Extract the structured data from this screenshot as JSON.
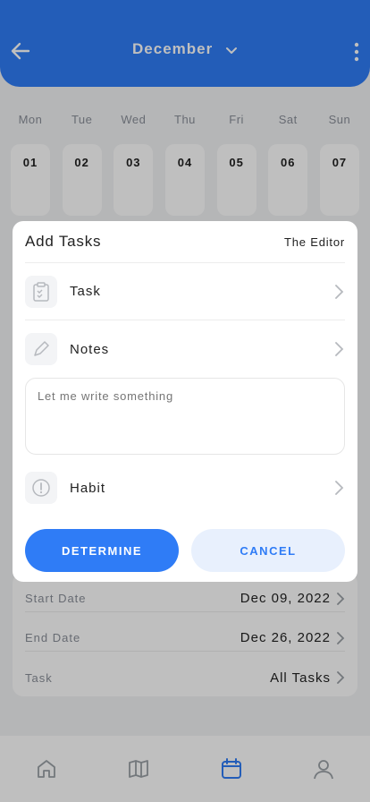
{
  "header": {
    "month": "December",
    "back_icon": "arrow-left-icon",
    "more_icon": "more-vertical-icon",
    "color": "#2f7cf6"
  },
  "week": [
    {
      "name": "Mon",
      "num": "01"
    },
    {
      "name": "Tue",
      "num": "02"
    },
    {
      "name": "Wed",
      "num": "03"
    },
    {
      "name": "Thu",
      "num": "04"
    },
    {
      "name": "Fri",
      "num": "05"
    },
    {
      "name": "Sat",
      "num": "06"
    },
    {
      "name": "Sun",
      "num": "07"
    }
  ],
  "dates": {
    "start_label": "Start Date",
    "start_value": "Dec 09, 2022",
    "end_label": "End Date",
    "end_value": "Dec 26, 2022",
    "task_label": "Task",
    "task_value": "All Tasks"
  },
  "modal": {
    "title": "Add Tasks",
    "editor": "The Editor",
    "task_label": "Task",
    "notes_label": "Notes",
    "notes_placeholder": "Let me write something",
    "habit_label": "Habit",
    "determine_label": "DETERMINE",
    "cancel_label": "CANCEL"
  },
  "nav": {
    "items": [
      "home-icon",
      "book-icon",
      "calendar-icon",
      "profile-icon"
    ],
    "active": "calendar-icon"
  }
}
